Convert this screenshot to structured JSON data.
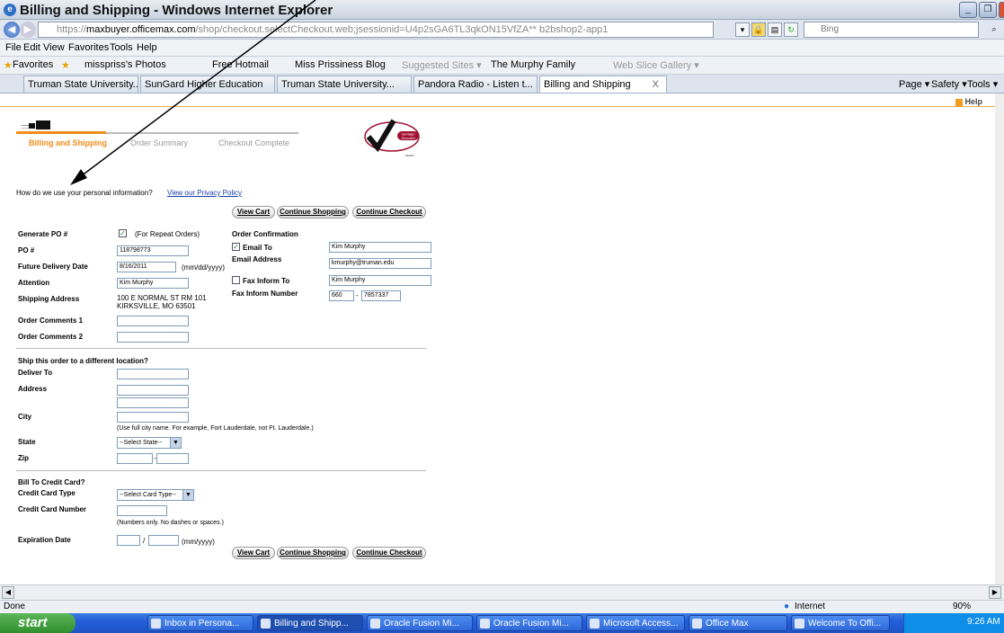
{
  "window": {
    "title": "Billing and Shipping - Windows Internet Explorer"
  },
  "browser": {
    "url_prefix": "https://",
    "url_host": "maxbuyer.officemax.com",
    "url_rest": "/shop/checkout.selectCheckout.web;jsessionid=U4p2sGA6TL3qkON15VfZA** b2bshop2-app1",
    "search_placeholder": "Bing",
    "menu": [
      "File",
      "Edit",
      "View",
      "Favorites",
      "Tools",
      "Help"
    ],
    "favorites": [
      "Favorites",
      "misspriss's Photos",
      "Free Hotmail",
      "Miss Prissiness Blog",
      "Suggested Sites ▾",
      "The Murphy Family",
      "Web Slice Gallery ▾"
    ],
    "tabs": [
      "Truman State University...",
      "SunGard Higher Education",
      "Truman State University...",
      "Pandora Radio - Listen t...",
      "Billing and Shipping"
    ],
    "tab_close": "X",
    "commands": [
      "Page ▾",
      "Safety ▾",
      "Tools ▾"
    ]
  },
  "page": {
    "help": "Help",
    "steps": [
      "Billing and Shipping",
      "Order Summary",
      "Checkout Complete"
    ],
    "verisign": [
      "VeriSign",
      "Secured",
      "VERIFY"
    ],
    "privacy_text": "How do we use your personal information?",
    "privacy_link": "View our Privacy Policy",
    "buttons": {
      "view_cart": "View Cart",
      "continue_shopping": "Continue Shopping",
      "continue_checkout": "Continue Checkout"
    },
    "generate_po": {
      "label": "Generate PO #",
      "note": "(For Repeat Orders)"
    },
    "po": {
      "label": "PO #",
      "value": "118798773"
    },
    "future_delivery": {
      "label": "Future Delivery Date",
      "value": "8/16/2011",
      "format": "(mm/dd/yyyy)"
    },
    "attention": {
      "label": "Attention",
      "value": "Kim Murphy"
    },
    "shipping_address": {
      "label": "Shipping Address",
      "line1": "100 E NORMAL ST RM 101",
      "line2": "KIRKSVILLE, MO 63501"
    },
    "order_comments_1": "Order Comments 1",
    "order_comments_2": "Order Comments 2",
    "order_confirmation": {
      "title": "Order Confirmation",
      "email_to": "Email To",
      "email_to_value": "Kim Murphy",
      "email_address": "Email Address",
      "email_address_value": "kmurphy@truman.edu",
      "fax_to": "Fax Inform To",
      "fax_to_value": "Kim Murphy",
      "fax_number": "Fax Inform Number",
      "fax_area": "660",
      "fax_number_value": "7857337"
    },
    "ship_diff": {
      "title": "Ship this order to a different location?",
      "deliver_to": "Deliver To",
      "address": "Address",
      "city": "City",
      "city_note": "(Use full city name. For example, Fort Lauderdale, not Ft. Lauderdale.)",
      "state": "State",
      "state_value": "--Select State--",
      "zip": "Zip",
      "zip_sep": "-"
    },
    "bill": {
      "title": "Bill To Credit Card?",
      "card_type": "Credit Card Type",
      "card_type_value": "--Select Card Type--",
      "card_number": "Credit Card Number",
      "card_note": "(Numbers only. No dashes or spaces.)",
      "expiration": "Expiration Date",
      "exp_sep": "/",
      "exp_format": "(mm/yyyy)"
    }
  },
  "status": {
    "left": "Done",
    "zone": "Internet",
    "zoom": "90%"
  },
  "taskbar": {
    "start": "start",
    "items": [
      "Inbox in Persona...",
      "Billing and Shipp...",
      "Oracle Fusion Mi...",
      "Oracle Fusion Mi...",
      "Microsoft Access...",
      "Office Max",
      "Welcome To Offi..."
    ],
    "time": "9:26 AM"
  }
}
